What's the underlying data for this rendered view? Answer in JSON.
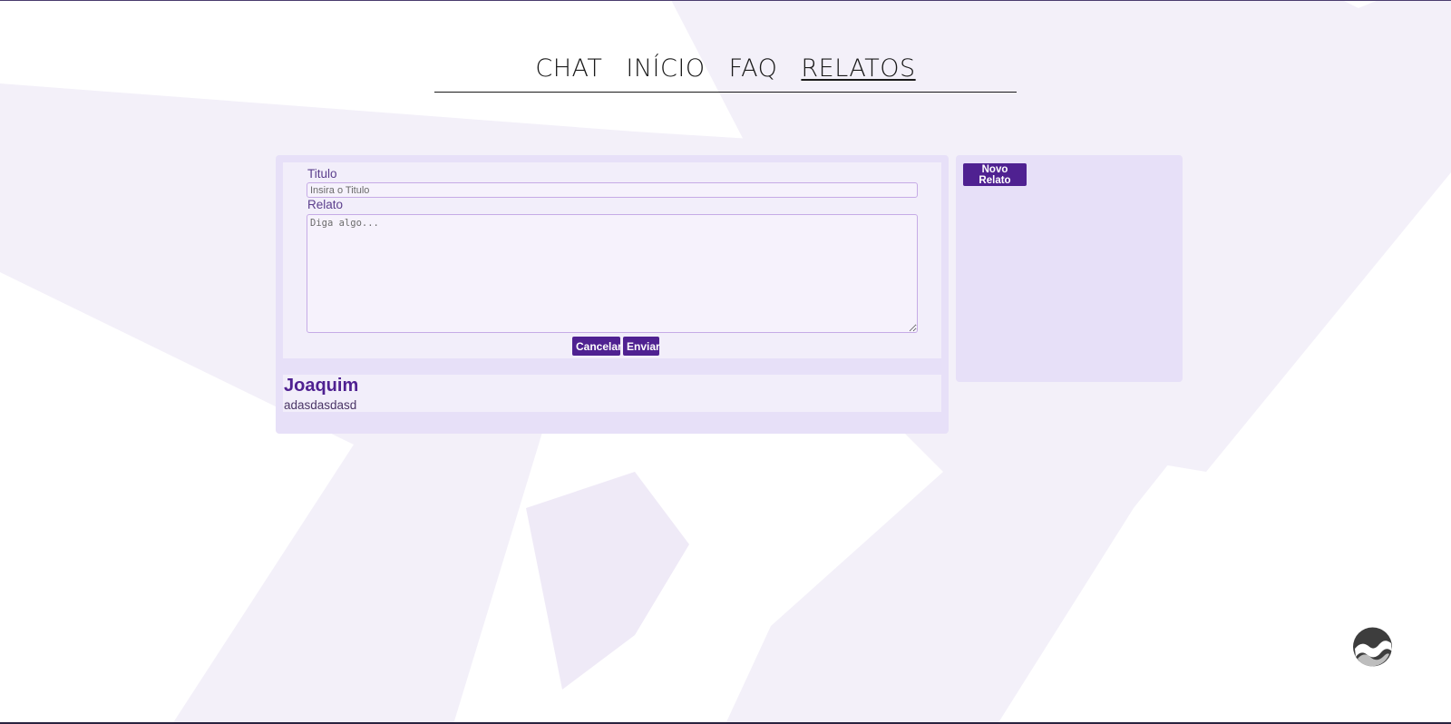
{
  "nav": {
    "items": [
      "CHAT",
      "INÍCIO",
      "FAQ",
      "RELATOS"
    ],
    "active": "RELATOS"
  },
  "form": {
    "title_label": "Titulo",
    "title_placeholder": "Insira o Titulo",
    "report_label": "Relato",
    "report_placeholder": "Diga algo...",
    "cancel_label": "Cancelar",
    "send_label": "Enviar"
  },
  "reports": [
    {
      "author": "Joaquim",
      "text": "adasdasdasd"
    }
  ],
  "sidebar": {
    "new_report_label": "Novo Relato"
  },
  "colors": {
    "accent": "#4f2191",
    "panel": "#e7e0f8",
    "card": "#f2eefa",
    "background_shape": "#f3f0f9"
  },
  "icons": {
    "logo": "hands-logo-icon"
  }
}
